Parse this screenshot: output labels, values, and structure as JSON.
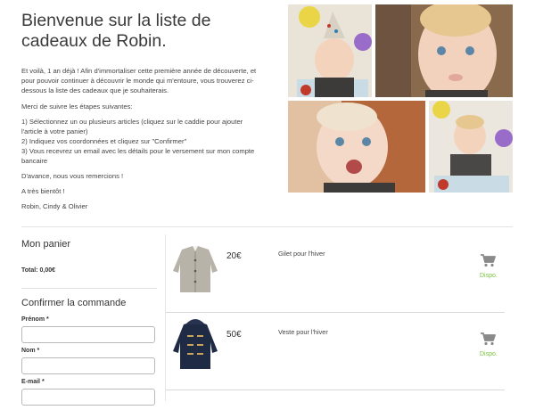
{
  "intro": {
    "title": "Bienvenue sur la liste de cadeaux de Robin.",
    "para1": "Et voilà, 1 an déjà ! Afin d'immortaliser cette première année de découverte, et pour pouvoir continuer à découvrir le monde qui m'entoure, vous trouverez ci-dessous la liste des cadeaux que je souhaiterais.",
    "para2": "Merci de suivre les étapes suivantes:",
    "step1": "1) Sélectionnez un ou plusieurs articles (cliquez sur le caddie pour ajouter l'article à votre panier)",
    "step2": "2) Indiquez vos coordonnées et cliquez sur \"Confirmer\"",
    "step3": "3) Vous recevrez un email avec les détails pour le versement sur mon compte bancaire",
    "thanks": "D'avance, nous vous remercions !",
    "bye": "A très bientôt !",
    "signature": "Robin, Cindy & Olivier"
  },
  "cart": {
    "heading": "Mon panier",
    "total": "Total: 0,00€"
  },
  "confirm": {
    "heading": "Confirmer la commande",
    "firstname_label": "Prénom *",
    "lastname_label": "Nom *",
    "email_label": "E-mail *",
    "firstname_value": "",
    "lastname_value": "",
    "email_value": ""
  },
  "products": [
    {
      "price": "20€",
      "name": "Gilet pour l'hiver",
      "status": "Dispo.",
      "image": "grey-knit-cardigan"
    },
    {
      "price": "50€",
      "name": "Veste pour l'hiver",
      "status": "Dispo.",
      "image": "navy-duffle-coat"
    }
  ],
  "colors": {
    "available": "#7ac142",
    "divider": "#e2e2e2",
    "cart_icon": "#8a8a8a"
  }
}
